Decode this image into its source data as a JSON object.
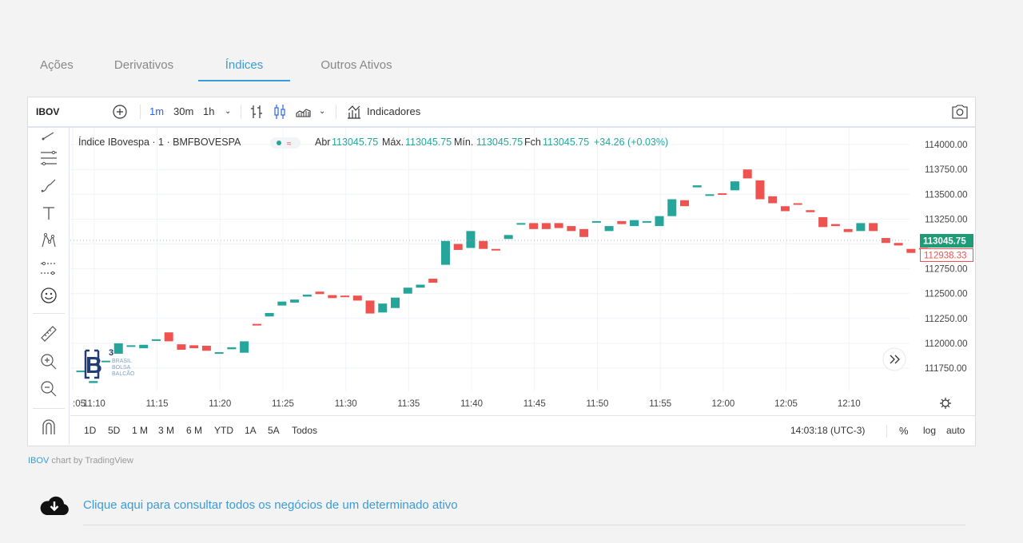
{
  "tabs": [
    {
      "label": "Ações",
      "active": false
    },
    {
      "label": "Derivativos",
      "active": false
    },
    {
      "label": "Índices",
      "active": true
    },
    {
      "label": "Outros Ativos",
      "active": false
    }
  ],
  "toolbar": {
    "symbol": "IBOV",
    "intervals": [
      "1m",
      "30m",
      "1h"
    ],
    "active_interval": "1m",
    "indicators_label": "Indicadores"
  },
  "legend": {
    "title": "Índice IBovespa · 1 · BMFBOVESPA",
    "open_label": "Abr",
    "open": "113045.75",
    "high_label": "Máx.",
    "high": "113045.75",
    "low_label": "Mín.",
    "low": "113045.75",
    "close_label": "Fch",
    "close": "113045.75",
    "change": "+34.26 (+0.03%)"
  },
  "price_badges": {
    "last": "113045.75",
    "previous_close": "112938.33"
  },
  "ranges": [
    "1D",
    "5D",
    "1 M",
    "3 M",
    "6 M",
    "YTD",
    "1A",
    "5A",
    "Todos"
  ],
  "bottom": {
    "clock": "14:03:18 (UTC-3)",
    "percent": "%",
    "log": "log",
    "auto": "auto"
  },
  "credit": {
    "symbol": "IBOV",
    "text": " chart by TradingView"
  },
  "logo": {
    "mark": "B",
    "sup": "3",
    "line1": "BRASIL",
    "line2": "BOLSA",
    "line3": "BALCÃO"
  },
  "download_link": "Clique aqui para consultar todos os negócios de um determinado ativo",
  "colors": {
    "up": "#26a69a",
    "down": "#ef5350",
    "accent": "#3a9bd9",
    "tv_blue": "#2962ff"
  },
  "chart_data": {
    "type": "candlestick",
    "title": "Índice IBovespa · 1 · BMFBOVESPA",
    "x_ticks": [
      ":05",
      "11:10",
      "11:15",
      "11:20",
      "11:25",
      "11:30",
      "11:35",
      "11:40",
      "11:45",
      "11:50",
      "11:55",
      "12:00",
      "12:05",
      "12:10"
    ],
    "y_ticks": [
      114000,
      113750,
      113500,
      113250,
      113000,
      112750,
      112500,
      112250,
      112000,
      111750
    ],
    "ylim": [
      111600,
      114080
    ],
    "grid": true,
    "candles": [
      {
        "t": "11:05",
        "o": 111715,
        "c": 111725
      },
      {
        "t": "11:06",
        "o": 111600,
        "c": 111620
      },
      {
        "t": "11:07",
        "o": 111810,
        "c": 111825
      },
      {
        "t": "11:08",
        "o": 111895,
        "c": 112000
      },
      {
        "t": "11:09",
        "o": 111970,
        "c": 111980
      },
      {
        "t": "11:10",
        "o": 111950,
        "c": 111985
      },
      {
        "t": "11:11",
        "o": 112030,
        "c": 112040
      },
      {
        "t": "11:12",
        "o": 112110,
        "c": 112020
      },
      {
        "t": "11:13",
        "o": 111990,
        "c": 111935
      },
      {
        "t": "11:14",
        "o": 111980,
        "c": 111950
      },
      {
        "t": "11:15",
        "o": 111975,
        "c": 111925
      },
      {
        "t": "11:16",
        "o": 111900,
        "c": 111910
      },
      {
        "t": "11:17",
        "o": 111940,
        "c": 111960
      },
      {
        "t": "11:18",
        "o": 111905,
        "c": 112020
      },
      {
        "t": "11:19",
        "o": 112195,
        "c": 112180
      },
      {
        "t": "11:20",
        "o": 112270,
        "c": 112305
      },
      {
        "t": "11:21",
        "o": 112380,
        "c": 112420
      },
      {
        "t": "11:22",
        "o": 112410,
        "c": 112440
      },
      {
        "t": "11:23",
        "o": 112470,
        "c": 112490
      },
      {
        "t": "11:24",
        "o": 112520,
        "c": 112495
      },
      {
        "t": "11:25",
        "o": 112485,
        "c": 112455
      },
      {
        "t": "11:26",
        "o": 112480,
        "c": 112470
      },
      {
        "t": "11:27",
        "o": 112480,
        "c": 112430
      },
      {
        "t": "11:28",
        "o": 112430,
        "c": 112300
      },
      {
        "t": "11:29",
        "o": 112310,
        "c": 112400
      },
      {
        "t": "11:30",
        "o": 112355,
        "c": 112460
      },
      {
        "t": "11:31",
        "o": 112500,
        "c": 112560
      },
      {
        "t": "11:32",
        "o": 112560,
        "c": 112590
      },
      {
        "t": "11:33",
        "o": 112650,
        "c": 112610
      },
      {
        "t": "11:34",
        "o": 112790,
        "c": 113030
      },
      {
        "t": "11:35",
        "o": 113000,
        "c": 112940
      },
      {
        "t": "11:36",
        "o": 112960,
        "c": 113130
      },
      {
        "t": "11:37",
        "o": 113030,
        "c": 112950
      },
      {
        "t": "11:38",
        "o": 112950,
        "c": 112940
      },
      {
        "t": "11:39",
        "o": 113050,
        "c": 113090
      },
      {
        "t": "11:40",
        "o": 113200,
        "c": 113210
      },
      {
        "t": "11:41",
        "o": 113210,
        "c": 113150
      },
      {
        "t": "11:42",
        "o": 113210,
        "c": 113150
      },
      {
        "t": "11:43",
        "o": 113210,
        "c": 113160
      },
      {
        "t": "11:44",
        "o": 113180,
        "c": 113130
      },
      {
        "t": "11:45",
        "o": 113150,
        "c": 113070
      },
      {
        "t": "11:46",
        "o": 113220,
        "c": 113230
      },
      {
        "t": "11:47",
        "o": 113130,
        "c": 113180
      },
      {
        "t": "11:48",
        "o": 113230,
        "c": 113200
      },
      {
        "t": "11:49",
        "o": 113180,
        "c": 113240
      },
      {
        "t": "11:50",
        "o": 113220,
        "c": 113230
      },
      {
        "t": "11:51",
        "o": 113180,
        "c": 113280
      },
      {
        "t": "11:52",
        "o": 113280,
        "c": 113450
      },
      {
        "t": "11:53",
        "o": 113440,
        "c": 113380
      },
      {
        "t": "11:54",
        "o": 113570,
        "c": 113590
      },
      {
        "t": "11:55",
        "o": 113500,
        "c": 113500
      },
      {
        "t": "11:56",
        "o": 113510,
        "c": 113500
      },
      {
        "t": "11:57",
        "o": 113540,
        "c": 113630
      },
      {
        "t": "11:58",
        "o": 113750,
        "c": 113660
      },
      {
        "t": "11:59",
        "o": 113640,
        "c": 113450
      },
      {
        "t": "12:00",
        "o": 113480,
        "c": 113410
      },
      {
        "t": "12:01",
        "o": 113380,
        "c": 113330
      },
      {
        "t": "12:02",
        "o": 113410,
        "c": 113395
      },
      {
        "t": "12:03",
        "o": 113340,
        "c": 113320
      },
      {
        "t": "12:04",
        "o": 113270,
        "c": 113170
      },
      {
        "t": "12:05",
        "o": 113200,
        "c": 113180
      },
      {
        "t": "12:06",
        "o": 113150,
        "c": 113120
      },
      {
        "t": "12:07",
        "o": 113130,
        "c": 113210
      },
      {
        "t": "12:08",
        "o": 113210,
        "c": 113130
      },
      {
        "t": "12:09",
        "o": 113060,
        "c": 113010
      },
      {
        "t": "12:10",
        "o": 113010,
        "c": 112985
      },
      {
        "t": "12:11",
        "o": 112950,
        "c": 112910
      },
      {
        "t": "12:12",
        "o": 112960,
        "c": 112945
      }
    ]
  }
}
